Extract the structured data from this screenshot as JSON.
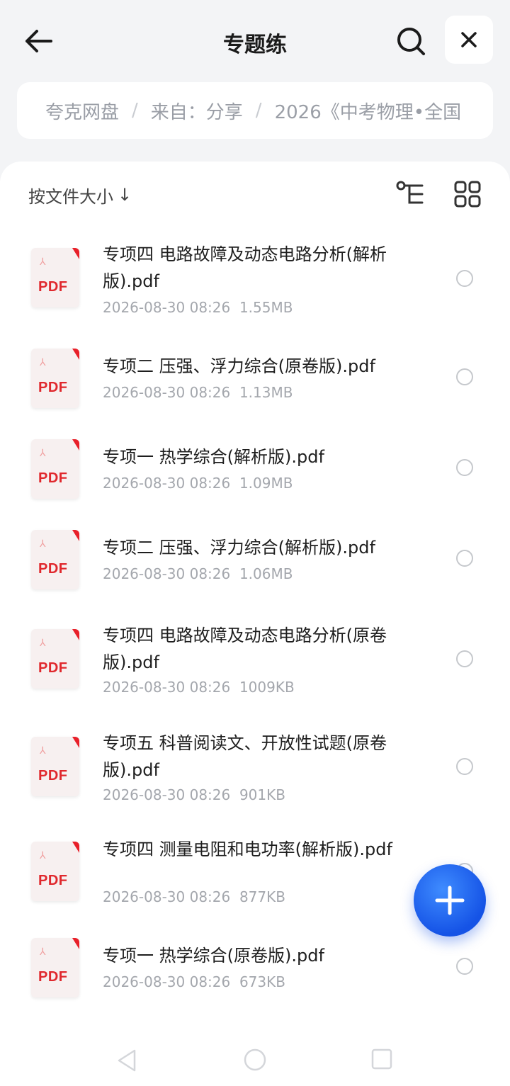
{
  "header": {
    "title": "专题练"
  },
  "breadcrumb": {
    "items": [
      "夸克网盘",
      "来自：分享",
      "2026《中考物理•全国"
    ]
  },
  "toolbar": {
    "sort_label": "按文件大小",
    "sort_arrow": "↓"
  },
  "files": [
    {
      "name": "专项四 电路故障及动态电路分析(解析版).pdf",
      "date": "2026-08-30 08:26",
      "size": "1.55MB",
      "icon_label": "PDF"
    },
    {
      "name": "专项二 压强、浮力综合(原卷版).pdf",
      "date": "2026-08-30 08:26",
      "size": "1.13MB",
      "icon_label": "PDF"
    },
    {
      "name": "专项一 热学综合(解析版).pdf",
      "date": "2026-08-30 08:26",
      "size": "1.09MB",
      "icon_label": "PDF"
    },
    {
      "name": "专项二 压强、浮力综合(解析版).pdf",
      "date": "2026-08-30 08:26",
      "size": "1.06MB",
      "icon_label": "PDF"
    },
    {
      "name": "专项四 电路故障及动态电路分析(原卷版).pdf",
      "date": "2026-08-30 08:26",
      "size": "1009KB",
      "icon_label": "PDF"
    },
    {
      "name": "专项五 科普阅读文、开放性试题(原卷版).pdf",
      "date": "2026-08-30 08:26",
      "size": "901KB",
      "icon_label": "PDF"
    },
    {
      "name": "专项四 测量电阻和电功率(解析版).pdf",
      "date": "2026-08-30 08:26",
      "size": "877KB",
      "icon_label": "PDF"
    },
    {
      "name": "专项一 热学综合(原卷版).pdf",
      "date": "2026-08-30 08:26",
      "size": "673KB",
      "icon_label": "PDF"
    }
  ],
  "colors": {
    "accent": "#1f63f0",
    "pdf_red": "#e0282d",
    "meta_gray": "#a4a7ad"
  }
}
